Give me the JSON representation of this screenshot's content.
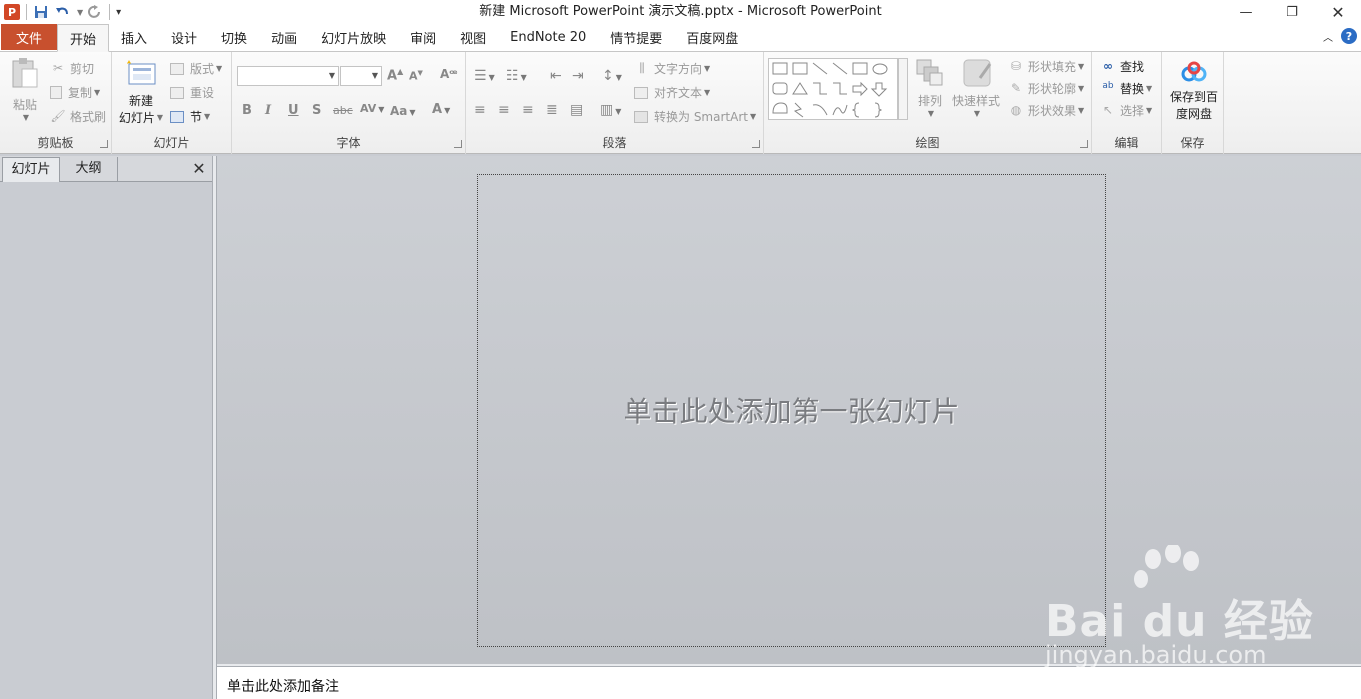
{
  "window": {
    "title": "新建 Microsoft PowerPoint 演示文稿.pptx  -  Microsoft PowerPoint",
    "app_icon_letter": "P"
  },
  "tabs": {
    "file": "文件",
    "items": [
      "开始",
      "插入",
      "设计",
      "切换",
      "动画",
      "幻灯片放映",
      "审阅",
      "视图",
      "EndNote 20",
      "情节提要",
      "百度网盘"
    ],
    "active_index": 0
  },
  "ribbon": {
    "clipboard": {
      "label": "剪贴板",
      "paste": "粘贴",
      "cut": "剪切",
      "copy": "复制",
      "format_painter": "格式刷"
    },
    "slides": {
      "label": "幻灯片",
      "new_slide_1": "新建",
      "new_slide_2": "幻灯片",
      "layout": "版式",
      "reset": "重设",
      "section": "节"
    },
    "font": {
      "label": "字体",
      "font_name": "",
      "font_size": ""
    },
    "paragraph": {
      "label": "段落",
      "text_direction": "文字方向",
      "align_text": "对齐文本",
      "convert_smartart": "转换为 SmartArt"
    },
    "drawing": {
      "label": "绘图",
      "arrange": "排列",
      "quick_styles": "快速样式",
      "shape_fill": "形状填充",
      "shape_outline": "形状轮廓",
      "shape_effects": "形状效果"
    },
    "editing": {
      "label": "编辑",
      "find": "查找",
      "replace": "替换",
      "select": "选择"
    },
    "save": {
      "label": "保存",
      "save_baidu_1": "保存到百",
      "save_baidu_2": "度网盘"
    }
  },
  "left_pane": {
    "tabs": [
      "幻灯片",
      "大纲"
    ],
    "active_index": 0
  },
  "slide": {
    "placeholder": "单击此处添加第一张幻灯片"
  },
  "notes": {
    "placeholder": "单击此处添加备注"
  },
  "watermark": {
    "brand": "Bai du 经验",
    "url": "jingyan.baidu.com"
  },
  "colors": {
    "file_tab": "#c8502e",
    "workspace": "#c9ccd2",
    "ribbon": "#f3f3f3"
  }
}
